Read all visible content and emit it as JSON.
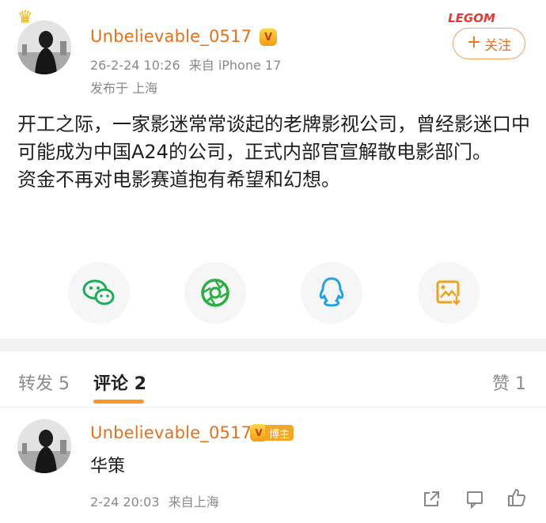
{
  "post": {
    "author": {
      "name": "Unbelievable_0517",
      "crown_icon": "crown-icon",
      "vip_icon": "vip-badge-icon"
    },
    "time": "26-2-24 10:26",
    "source": "来自 iPhone 17",
    "location": "发布于 上海",
    "follow_label": "关注",
    "deco_tag": "LEGOM",
    "text": "开工之际，一家影迷常常谈起的老牌影视公司，曾经影迷口中可能成为中国A24的公司，正式内部官宣解散电影部门。\n资金不再对电影赛道抱有希望和幻想。"
  },
  "share": [
    {
      "name": "wechat",
      "icon": "wechat-icon",
      "color": "#1aad5b"
    },
    {
      "name": "moments",
      "icon": "moments-icon",
      "color": "#27b03f"
    },
    {
      "name": "qq",
      "icon": "qq-icon",
      "color": "#1ea2e8"
    },
    {
      "name": "save-image",
      "icon": "image-download-icon",
      "color": "#f0a21c"
    }
  ],
  "tabs": {
    "repost": "转发 5",
    "comments": "评论 2",
    "likes": "赞 1"
  },
  "comment": {
    "author": "Unbelievable_0517",
    "badge": "博主",
    "text": "华策",
    "time": "2-24 20:03",
    "location": "来自上海",
    "actions": [
      "share-icon",
      "comment-icon",
      "like-icon"
    ]
  },
  "colors": {
    "accent": "#e8701a",
    "tab_indicator": "#f59a23"
  }
}
